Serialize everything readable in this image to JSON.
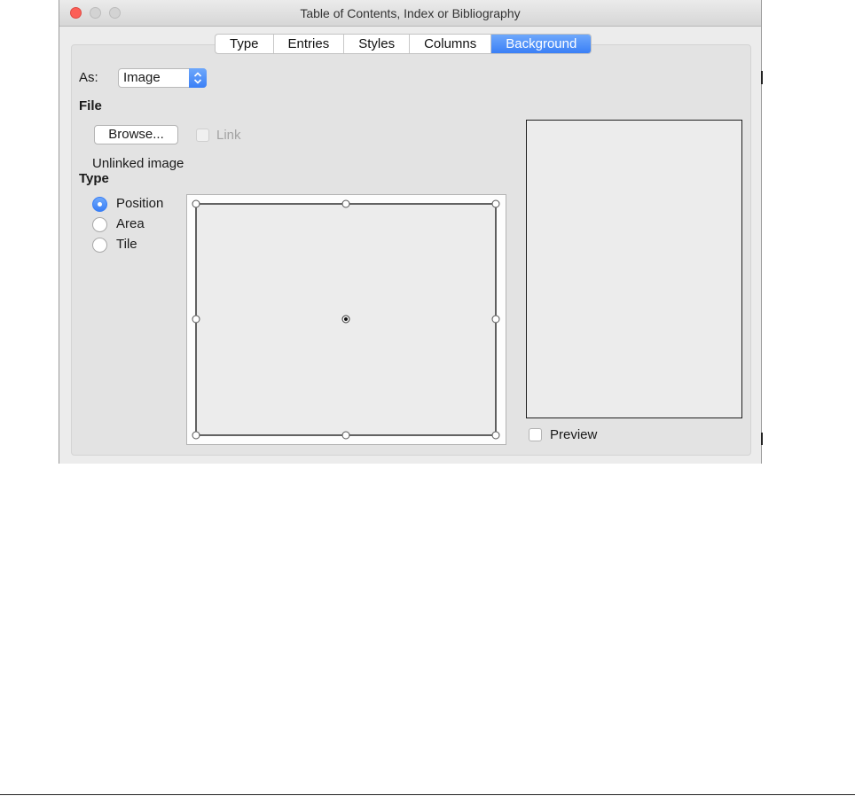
{
  "window": {
    "title": "Table of Contents, Index or Bibliography"
  },
  "tabs": [
    {
      "label": "Type"
    },
    {
      "label": "Entries"
    },
    {
      "label": "Styles"
    },
    {
      "label": "Columns"
    },
    {
      "label": "Background"
    }
  ],
  "active_tab": "Background",
  "as": {
    "label": "As:",
    "value": "Image"
  },
  "file": {
    "heading": "File",
    "browse_label": "Browse...",
    "link_label": "Link",
    "status": "Unlinked image"
  },
  "type": {
    "heading": "Type",
    "options": [
      {
        "label": "Position",
        "selected": true
      },
      {
        "label": "Area",
        "selected": false
      },
      {
        "label": "Tile",
        "selected": false
      }
    ]
  },
  "preview": {
    "label": "Preview",
    "checked": false
  },
  "colors": {
    "accent": "#3a7ff6",
    "close": "#fc5f57"
  }
}
